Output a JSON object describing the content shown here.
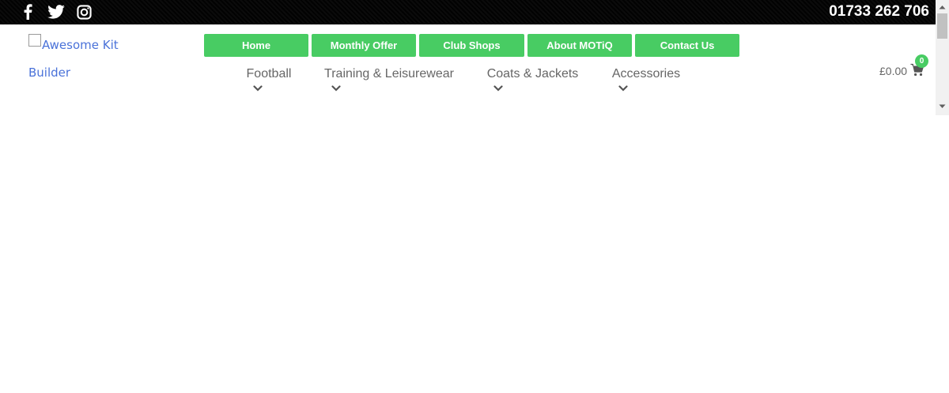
{
  "topbar": {
    "phone": "01733 262 706",
    "social_icons": [
      "facebook-icon",
      "twitter-icon",
      "instagram-icon"
    ]
  },
  "logo": {
    "line1": "Awesome Kit",
    "line2": "Builder"
  },
  "nav_buttons": [
    {
      "label": "Home"
    },
    {
      "label": "Monthly Offer"
    },
    {
      "label": "Club Shops"
    },
    {
      "label": "About MOTiQ"
    },
    {
      "label": "Contact Us"
    }
  ],
  "menu": [
    {
      "label": "Football"
    },
    {
      "label": "Training & Leisurewear"
    },
    {
      "label": "Coats & Jackets"
    },
    {
      "label": "Accessories"
    }
  ],
  "cart": {
    "total": "£0.00",
    "count": "0"
  },
  "colors": {
    "accent": "#48cc63",
    "topbar": "#060606",
    "link": "#4a72d9",
    "menu_text": "#666666"
  }
}
